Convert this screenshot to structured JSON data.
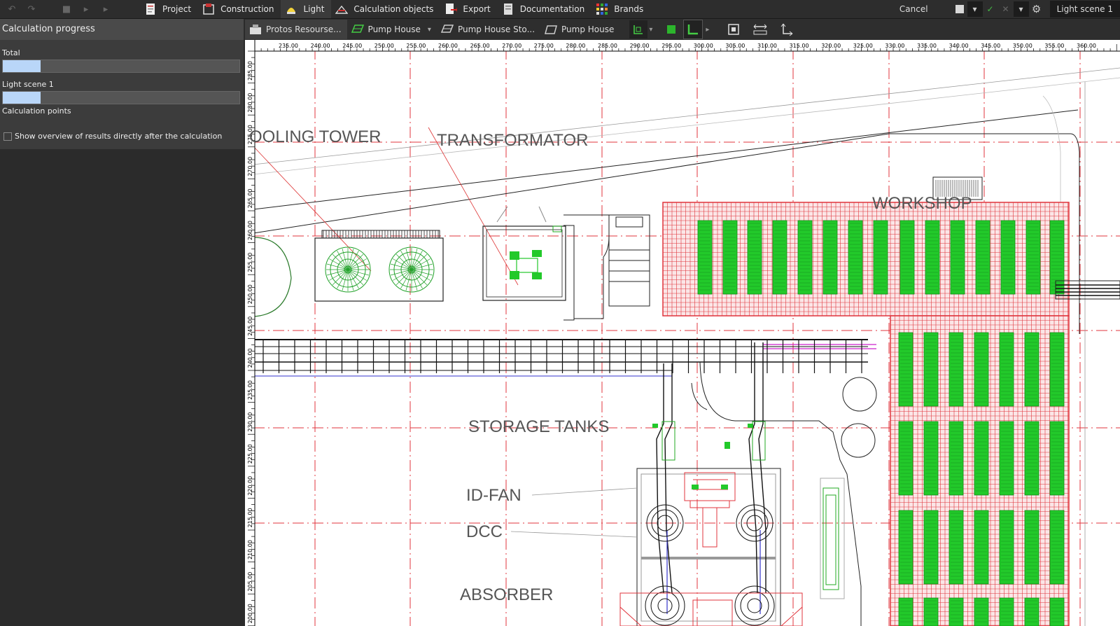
{
  "menu": {
    "items": [
      {
        "id": "project",
        "label": "Project"
      },
      {
        "id": "construction",
        "label": "Construction"
      },
      {
        "id": "light",
        "label": "Light"
      },
      {
        "id": "calculation-objects",
        "label": "Calculation objects"
      },
      {
        "id": "export",
        "label": "Export"
      },
      {
        "id": "documentation",
        "label": "Documentation"
      },
      {
        "id": "brands",
        "label": "Brands"
      }
    ],
    "active": "light"
  },
  "top_right": {
    "cancel_label": "Cancel",
    "scene_label": "Light scene 1"
  },
  "panel": {
    "title": "Calculation progress",
    "total_label": "Total",
    "total_progress": 0.16,
    "scene_label": "Light scene 1",
    "scene_progress": 0.16,
    "points_label": "Calculation points",
    "checkbox_label": "Show overview of results directly after the calculation",
    "checkbox_checked": false
  },
  "tabs": [
    {
      "label": "Protos Resourse...",
      "active": true
    },
    {
      "label": "Pump House",
      "dropdown": true
    },
    {
      "label": "Pump House Sto..."
    },
    {
      "label": "Pump House"
    }
  ],
  "ruler": {
    "top": [
      "235.00",
      "240.00",
      "245.00",
      "250.00",
      "255.00",
      "260.00",
      "265.00",
      "270.00",
      "275.00",
      "280.00",
      "285.00",
      "290.00",
      "295.00",
      "300.00",
      "305.00",
      "310.00",
      "315.00",
      "320.00",
      "325.00",
      "330.00",
      "335.00",
      "340.00",
      "345.00",
      "350.00",
      "355.00",
      "360.00"
    ],
    "left": [
      "285.00",
      "280.00",
      "275.00",
      "270.00",
      "265.00",
      "260.00",
      "255.00",
      "250.00",
      "245.00",
      "240.00",
      "235.00",
      "230.00",
      "225.00",
      "220.00",
      "215.00",
      "210.00",
      "205.00",
      "200.00"
    ]
  },
  "labels": {
    "cooling": "OOLING TOWER",
    "transformator": "TRANSFORMATOR",
    "workshop": "WORKSHOP",
    "storage": "STORAGE TANKS",
    "idfan": "ID-FAN",
    "dcc": "DCC",
    "absorber": "ABSORBER"
  },
  "colors": {
    "grid_red": "#e0343c",
    "luminaire_green": "#22c92a",
    "accent": "#b9d6f8"
  }
}
